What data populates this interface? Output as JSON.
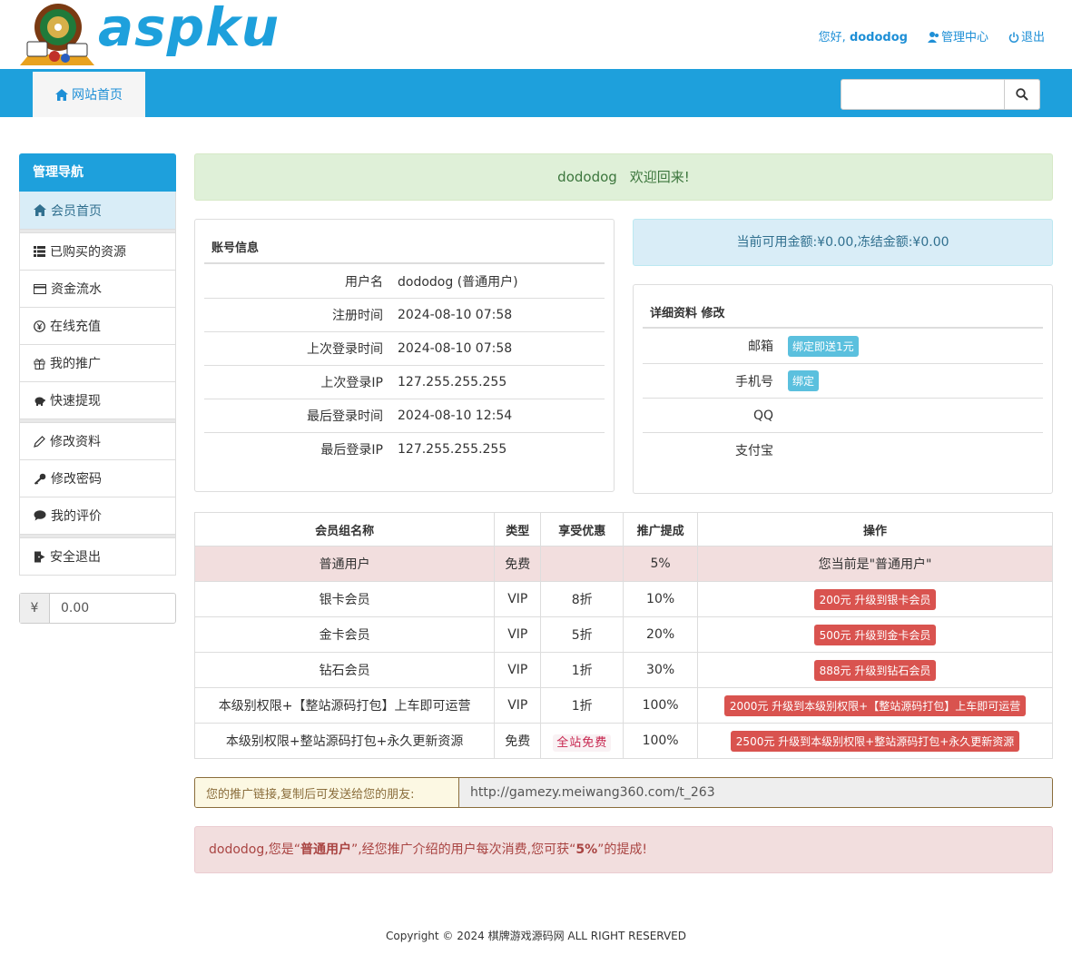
{
  "header": {
    "logo_text": "aspku",
    "greeting": "您好,",
    "username": "dododog",
    "admin_label": "管理中心",
    "logout_label": "退出"
  },
  "nav": {
    "home_label": "网站首页",
    "search_placeholder": ""
  },
  "sidebar": {
    "title": "管理导航",
    "groups": [
      [
        {
          "label": "会员首页",
          "icon": "home-icon"
        }
      ],
      [
        {
          "label": "已购买的资源",
          "icon": "list-icon"
        },
        {
          "label": "资金流水",
          "icon": "credit-card-icon"
        },
        {
          "label": "在线充值",
          "icon": "yen-circle-icon"
        },
        {
          "label": "我的推广",
          "icon": "gift-icon"
        },
        {
          "label": "快速提现",
          "icon": "piggy-bank-icon"
        }
      ],
      [
        {
          "label": "修改资料",
          "icon": "pencil-icon"
        },
        {
          "label": "修改密码",
          "icon": "key-icon"
        },
        {
          "label": "我的评价",
          "icon": "comment-icon"
        }
      ],
      [
        {
          "label": "安全退出",
          "icon": "logout-icon"
        }
      ]
    ],
    "balance_symbol": "¥",
    "balance_value": "0.00"
  },
  "welcome": {
    "name": "dododog",
    "message": "欢迎回来!"
  },
  "account": {
    "title": "账号信息",
    "rows": [
      {
        "key": "用户名",
        "value": "dododog (普通用户)"
      },
      {
        "key": "注册时间",
        "value": "2024-08-10 07:58"
      },
      {
        "key": "上次登录时间",
        "value": "2024-08-10 07:58"
      },
      {
        "key": "上次登录IP",
        "value": "127.255.255.255"
      },
      {
        "key": "最后登录时间",
        "value": "2024-08-10 12:54"
      },
      {
        "key": "最后登录IP",
        "value": "127.255.255.255"
      }
    ]
  },
  "funds": {
    "text": "当前可用金额:¥0.00,冻结金额:¥0.00"
  },
  "detail": {
    "title": "详细资料 修改",
    "rows": [
      {
        "key": "邮箱",
        "badge": "绑定即送1元"
      },
      {
        "key": "手机号",
        "badge": "绑定"
      },
      {
        "key": "QQ",
        "badge": ""
      },
      {
        "key": "支付宝",
        "badge": ""
      }
    ]
  },
  "levels": {
    "headers": [
      "会员组名称",
      "类型",
      "享受优惠",
      "推广提成",
      "操作"
    ],
    "rows": [
      {
        "name": "普通用户",
        "type": "免费",
        "discount": "",
        "commission": "5%",
        "action": "您当前是\"普通用户\"",
        "action_kind": "text"
      },
      {
        "name": "银卡会员",
        "type": "VIP",
        "discount": "8折",
        "commission": "10%",
        "action": "200元 升级到银卡会员",
        "action_kind": "button"
      },
      {
        "name": "金卡会员",
        "type": "VIP",
        "discount": "5折",
        "commission": "20%",
        "action": "500元 升级到金卡会员",
        "action_kind": "button"
      },
      {
        "name": "钻石会员",
        "type": "VIP",
        "discount": "1折",
        "commission": "30%",
        "action": "888元 升级到钻石会员",
        "action_kind": "button"
      },
      {
        "name": "本级别权限+【整站源码打包】上车即可运营",
        "type": "VIP",
        "discount": "1折",
        "commission": "100%",
        "action": "2000元 升级到本级别权限+【整站源码打包】上车即可运营",
        "action_kind": "button"
      },
      {
        "name": "本级别权限+整站源码打包+永久更新资源",
        "type": "免费",
        "discount": "全站免费",
        "commission": "100%",
        "action": "2500元 升级到本级别权限+整站源码打包+永久更新资源",
        "action_kind": "button"
      }
    ]
  },
  "promo": {
    "label": "您的推广链接,复制后可发送给您的朋友:",
    "url": "http://gamezy.meiwang360.com/t_263"
  },
  "notice": {
    "name": "dododog",
    "part1": ",您是“",
    "level": "普通用户",
    "part2": "”,经您推广介绍的用户每次消费,您可获“",
    "rate": "5%",
    "part3": "”的提成!"
  },
  "footer": {
    "text": "Copyright © 2024 棋牌游戏源码网 ALL RIGHT RESERVED"
  },
  "colors": {
    "brand": "#1ea0dc",
    "danger": "#d9534f",
    "info": "#5bc0de"
  }
}
